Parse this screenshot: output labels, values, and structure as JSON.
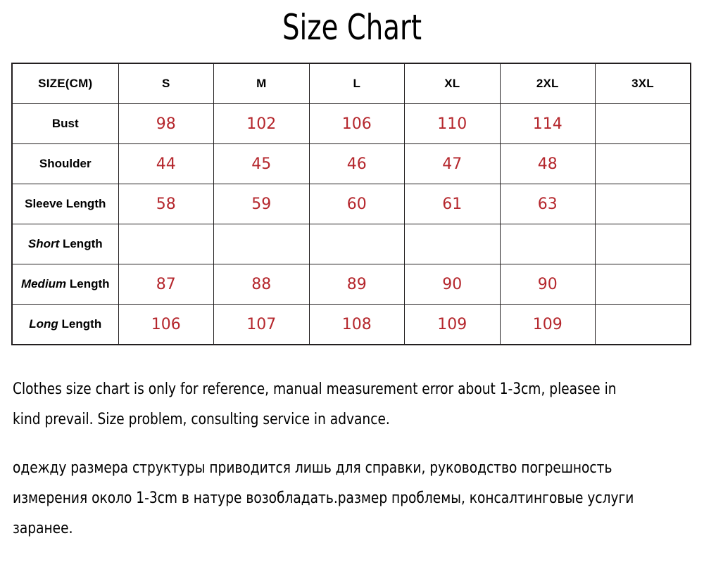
{
  "title": "Size Chart",
  "table": {
    "headers": [
      "SIZE(CM)",
      "S",
      "M",
      "L",
      "XL",
      "2XL",
      "3XL"
    ],
    "rows": [
      {
        "label_italic": "",
        "label_rest": "Bust",
        "values": [
          "98",
          "102",
          "106",
          "110",
          "114",
          ""
        ]
      },
      {
        "label_italic": "",
        "label_rest": "Shoulder",
        "values": [
          "44",
          "45",
          "46",
          "47",
          "48",
          ""
        ]
      },
      {
        "label_italic": "",
        "label_rest": "Sleeve Length",
        "values": [
          "58",
          "59",
          "60",
          "61",
          "63",
          ""
        ]
      },
      {
        "label_italic": "Short",
        "label_rest": " Length",
        "values": [
          "",
          "",
          "",
          "",
          "",
          ""
        ]
      },
      {
        "label_italic": "Medium",
        "label_rest": " Length",
        "values": [
          "87",
          "88",
          "89",
          "90",
          "90",
          ""
        ]
      },
      {
        "label_italic": "Long",
        "label_rest": " Length",
        "values": [
          "106",
          "107",
          "108",
          "109",
          "109",
          ""
        ]
      }
    ]
  },
  "notes": {
    "english": "Clothes size chart is only for reference, manual measurement error about 1-3cm, pleasee in kind prevail. Size problem, consulting service in advance.",
    "russian": "одежду размера структуры приводится лишь для справки, руководство погрешность измерения около 1-3cm в натуре возобладать.размер проблемы, консалтинговые услуги заранее."
  },
  "colors": {
    "value_red": "#b5272d",
    "border": "#231f20",
    "text": "#000000",
    "background": "#ffffff"
  }
}
